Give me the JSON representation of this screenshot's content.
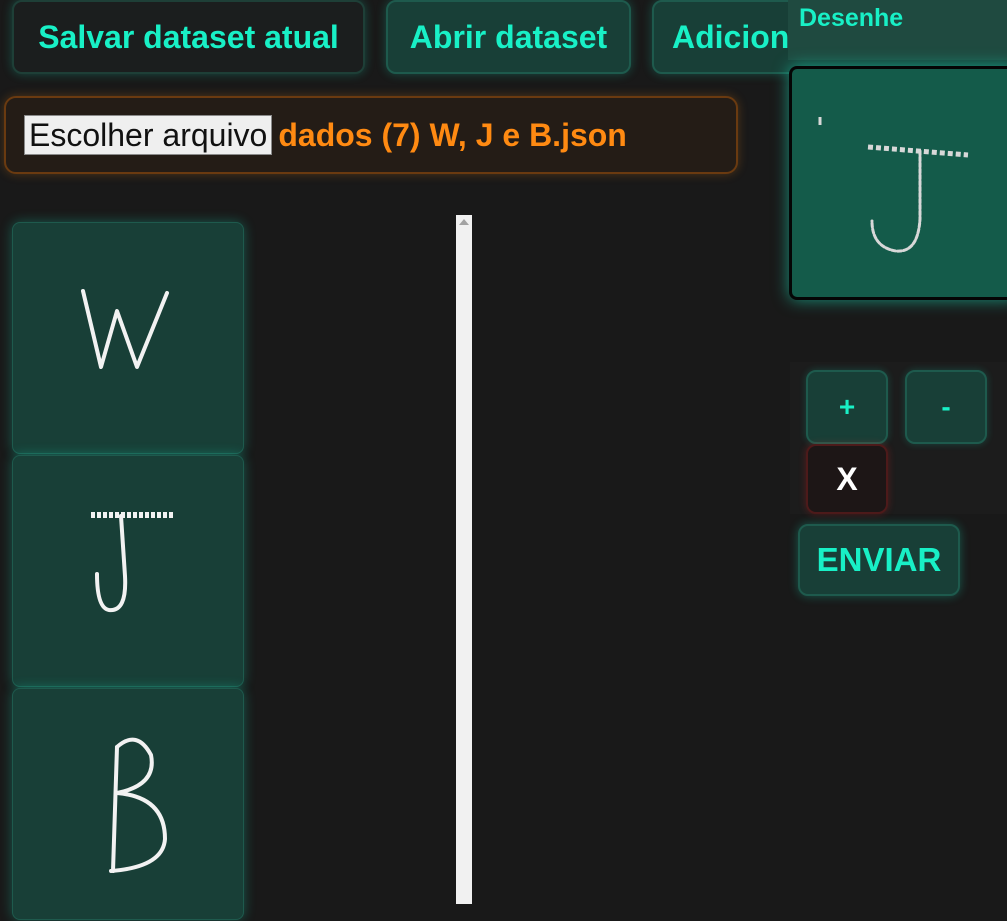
{
  "toolbar": {
    "save_label": "Salvar dataset atual",
    "open_label": "Abrir dataset",
    "add_label": "Adicionar desenho"
  },
  "file_input": {
    "button_label": "Escolher arquivo",
    "file_name": "dados (7) W, J e B.json"
  },
  "gallery": {
    "items": [
      {
        "letter": "W"
      },
      {
        "letter": "J"
      },
      {
        "letter": "B"
      }
    ]
  },
  "draw_panel": {
    "title": "Desenhe",
    "current_letter": "J"
  },
  "controls": {
    "plus_label": "+",
    "minus_label": "-",
    "clear_label": "X",
    "send_label": "ENVIAR"
  },
  "colors": {
    "accent": "#18f0c6",
    "file_accent": "#ff8a12",
    "background": "#191919",
    "card": "#183f37"
  }
}
